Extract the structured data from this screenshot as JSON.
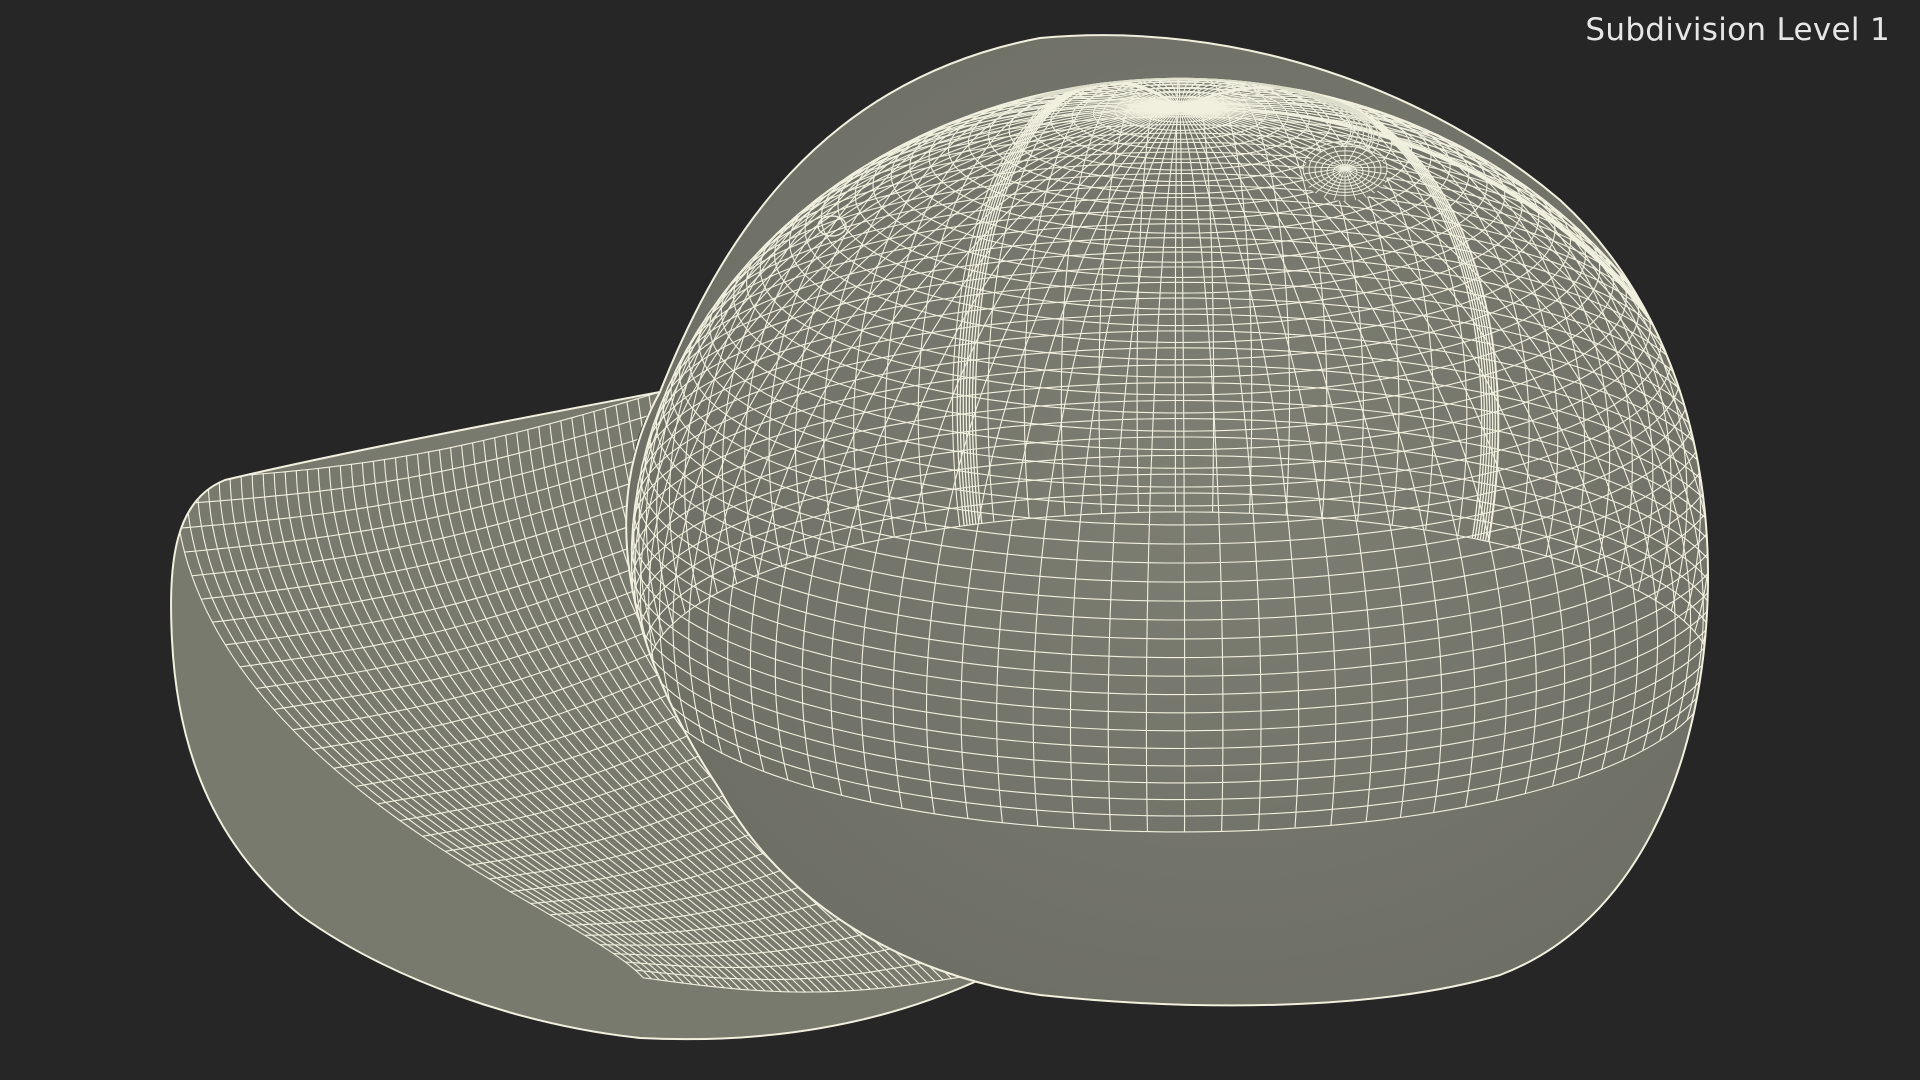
{
  "viewport": {
    "label": "Subdivision Level 1",
    "background_color": "#262626",
    "label_color": "#e6e6e6"
  },
  "model": {
    "surface_color": "#797a6e",
    "surface_shade_color": "#64655b",
    "wire_color": "#f1f0df",
    "wire_faint_color": "#dcdccb"
  }
}
